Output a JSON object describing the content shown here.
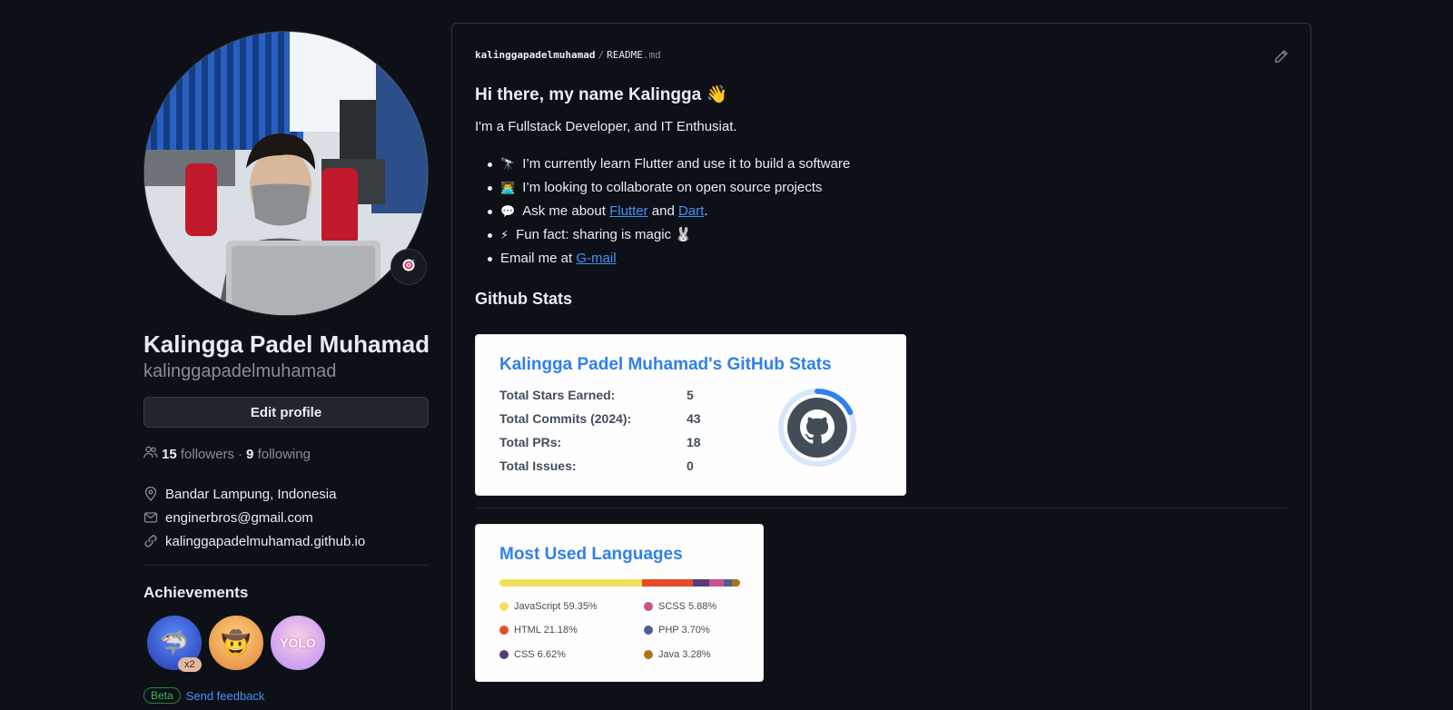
{
  "profile": {
    "full_name": "Kalingga Padel Muhamad",
    "username": "kalinggapadelmuhamad",
    "edit_button": "Edit profile",
    "followers_count": "15",
    "followers_label": "followers",
    "separator": "·",
    "following_count": "9",
    "following_label": "following",
    "location": "Bandar Lampung, Indonesia",
    "email": "enginerbros@gmail.com",
    "website": "kalinggapadelmuhamad.github.io",
    "status_icon": "target-emoji"
  },
  "achievements": {
    "title": "Achievements",
    "badges": [
      {
        "name": "shark-badge",
        "glyph": "🦈",
        "count": "x2",
        "color": "#3b5bd9"
      },
      {
        "name": "cowboy-badge",
        "glyph": "🤠",
        "color": "#f2a54a"
      },
      {
        "name": "yolo-badge",
        "glyph": "YOLO",
        "color": "#f3a0c6"
      }
    ],
    "beta_label": "Beta",
    "feedback_link": "Send feedback"
  },
  "readme": {
    "breadcrumb_user": "kalinggapadelmuhamad",
    "breadcrumb_sep": "/",
    "breadcrumb_file": "README",
    "breadcrumb_ext": ".md",
    "heading": "Hi there, my name Kalingga",
    "heading_emoji": "👋",
    "intro": "I'm a Fullstack Developer, and IT Enthusiat.",
    "bullets": [
      {
        "emoji": "🔭",
        "text": "I’m currently learn Flutter and use it to build a software"
      },
      {
        "emoji": "👨‍💻",
        "text": "I’m looking to collaborate on open source projects"
      },
      {
        "emoji": "💬",
        "text_before": "Ask me about ",
        "link1": "Flutter",
        "text_mid": " and ",
        "link2": "Dart",
        "text_after": "."
      },
      {
        "emoji": "⚡",
        "text": "Fun fact: sharing is magic 🐰"
      },
      {
        "text_before": "Email me at ",
        "link": "G-mail"
      }
    ],
    "stats_heading": "Github Stats"
  },
  "stats_card": {
    "title": "Kalingga Padel Muhamad's GitHub Stats",
    "rows": [
      {
        "label": "Total Stars Earned:",
        "value": "5"
      },
      {
        "label": "Total Commits (2024):",
        "value": "43"
      },
      {
        "label": "Total PRs:",
        "value": "18"
      },
      {
        "label": "Total Issues:",
        "value": "0"
      }
    ],
    "ring_progress": 0.18,
    "ring_color": "#2f80ed"
  },
  "lang_card": {
    "title": "Most Used Languages",
    "languages": [
      {
        "name": "JavaScript",
        "percent": 59.35,
        "label": "JavaScript 59.35%",
        "color": "#f1e05a"
      },
      {
        "name": "HTML",
        "percent": 21.18,
        "label": "HTML 21.18%",
        "color": "#e34c26"
      },
      {
        "name": "CSS",
        "percent": 6.62,
        "label": "CSS 6.62%",
        "color": "#563d7c"
      },
      {
        "name": "SCSS",
        "percent": 5.88,
        "label": "SCSS 5.88%",
        "color": "#c6538c"
      },
      {
        "name": "PHP",
        "percent": 3.7,
        "label": "PHP 3.70%",
        "color": "#4F5D95"
      },
      {
        "name": "Java",
        "percent": 3.28,
        "label": "Java 3.28%",
        "color": "#b07219"
      }
    ]
  }
}
